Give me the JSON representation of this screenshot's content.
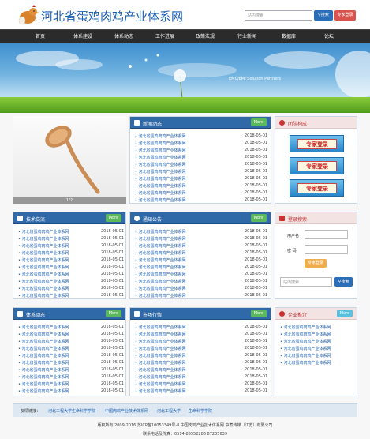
{
  "header": {
    "site_title": "河北省蛋鸡肉鸡产业体系网",
    "search_placeholder": "站内搜索",
    "search_button": "搜索",
    "login_button": "专家登录"
  },
  "nav": {
    "items": [
      "首页",
      "体系建设",
      "体系动态",
      "工作进展",
      "政策法规",
      "行业新闻",
      "数据库",
      "论坛"
    ]
  },
  "banner": {
    "text": "EMC/EMI Solution Partners"
  },
  "featured_image": {
    "caption": "1/2"
  },
  "news": {
    "title": "新闻动态",
    "more": "More",
    "items": [
      {
        "title": "河北省蛋鸡肉鸡产业体系网",
        "date": "2018-05-01"
      },
      {
        "title": "河北省蛋鸡肉鸡产业体系网",
        "date": "2018-05-01"
      },
      {
        "title": "河北省蛋鸡肉鸡产业体系网",
        "date": "2018-05-01"
      },
      {
        "title": "河北省蛋鸡肉鸡产业体系网",
        "date": "2018-05-01"
      },
      {
        "title": "河北省蛋鸡肉鸡产业体系网",
        "date": "2018-05-01"
      },
      {
        "title": "河北省蛋鸡肉鸡产业体系网",
        "date": "2018-05-01"
      },
      {
        "title": "河北省蛋鸡肉鸡产业体系网",
        "date": "2018-05-01"
      },
      {
        "title": "河北省蛋鸡肉鸡产业体系网",
        "date": "2018-05-01"
      },
      {
        "title": "河北省蛋鸡肉鸡产业体系网",
        "date": "2018-05-01"
      },
      {
        "title": "河北省蛋鸡肉鸡产业体系网",
        "date": "2018-05-01"
      }
    ]
  },
  "team": {
    "title": "团队构成",
    "experts": [
      "专家登录",
      "专家登录",
      "专家登录"
    ]
  },
  "tech": {
    "title": "技术交流",
    "more": "More",
    "items": [
      {
        "title": "河北省蛋鸡肉鸡产业体系网",
        "date": "2018-05-01"
      },
      {
        "title": "河北省蛋鸡肉鸡产业体系网",
        "date": "2018-05-01"
      },
      {
        "title": "河北省蛋鸡肉鸡产业体系网",
        "date": "2018-05-01"
      },
      {
        "title": "河北省蛋鸡肉鸡产业体系网",
        "date": "2018-05-01"
      },
      {
        "title": "河北省蛋鸡肉鸡产业体系网",
        "date": "2018-05-01"
      },
      {
        "title": "河北省蛋鸡肉鸡产业体系网",
        "date": "2018-05-01"
      },
      {
        "title": "河北省蛋鸡肉鸡产业体系网",
        "date": "2018-05-01"
      },
      {
        "title": "河北省蛋鸡肉鸡产业体系网",
        "date": "2018-05-01"
      },
      {
        "title": "河北省蛋鸡肉鸡产业体系网",
        "date": "2018-05-01"
      },
      {
        "title": "河北省蛋鸡肉鸡产业体系网",
        "date": "2018-05-01"
      }
    ]
  },
  "notice": {
    "title": "通知公告",
    "more": "More",
    "items": [
      {
        "title": "河北省蛋鸡肉鸡产业体系网",
        "date": "2018-05-01"
      },
      {
        "title": "河北省蛋鸡肉鸡产业体系网",
        "date": "2018-05-01"
      },
      {
        "title": "河北省蛋鸡肉鸡产业体系网",
        "date": "2018-05-01"
      },
      {
        "title": "河北省蛋鸡肉鸡产业体系网",
        "date": "2018-05-01"
      },
      {
        "title": "河北省蛋鸡肉鸡产业体系网",
        "date": "2018-05-01"
      },
      {
        "title": "河北省蛋鸡肉鸡产业体系网",
        "date": "2018-05-01"
      },
      {
        "title": "河北省蛋鸡肉鸡产业体系网",
        "date": "2018-05-01"
      },
      {
        "title": "河北省蛋鸡肉鸡产业体系网",
        "date": "2018-05-01"
      },
      {
        "title": "河北省蛋鸡肉鸡产业体系网",
        "date": "2018-05-01"
      },
      {
        "title": "河北省蛋鸡肉鸡产业体系网",
        "date": "2018-05-01"
      }
    ]
  },
  "login": {
    "title": "登录搜索",
    "username_label": "用户名",
    "password_label": "密 码",
    "login_button": "专家登录",
    "search_placeholder": "站内搜索",
    "search_button": "搜索"
  },
  "system": {
    "title": "体系动态",
    "more": "More",
    "items": [
      {
        "title": "河北省蛋鸡肉鸡产业体系网",
        "date": "2018-05-01"
      },
      {
        "title": "河北省蛋鸡肉鸡产业体系网",
        "date": "2018-05-01"
      },
      {
        "title": "河北省蛋鸡肉鸡产业体系网",
        "date": "2018-05-01"
      },
      {
        "title": "河北省蛋鸡肉鸡产业体系网",
        "date": "2018-05-01"
      },
      {
        "title": "河北省蛋鸡肉鸡产业体系网",
        "date": "2018-05-01"
      },
      {
        "title": "河北省蛋鸡肉鸡产业体系网",
        "date": "2018-05-01"
      },
      {
        "title": "河北省蛋鸡肉鸡产业体系网",
        "date": "2018-05-01"
      },
      {
        "title": "河北省蛋鸡肉鸡产业体系网",
        "date": "2018-05-01"
      },
      {
        "title": "河北省蛋鸡肉鸡产业体系网",
        "date": "2018-05-01"
      },
      {
        "title": "河北省蛋鸡肉鸡产业体系网",
        "date": "2018-05-01"
      }
    ]
  },
  "market": {
    "title": "市场行情",
    "more": "More",
    "items": [
      {
        "title": "河北省蛋鸡肉鸡产业体系网",
        "date": "2018-05-01"
      },
      {
        "title": "河北省蛋鸡肉鸡产业体系网",
        "date": "2018-05-01"
      },
      {
        "title": "河北省蛋鸡肉鸡产业体系网",
        "date": "2018-05-01"
      },
      {
        "title": "河北省蛋鸡肉鸡产业体系网",
        "date": "2018-05-01"
      },
      {
        "title": "河北省蛋鸡肉鸡产业体系网",
        "date": "2018-05-01"
      },
      {
        "title": "河北省蛋鸡肉鸡产业体系网",
        "date": "2018-05-01"
      },
      {
        "title": "河北省蛋鸡肉鸡产业体系网",
        "date": "2018-05-01"
      },
      {
        "title": "河北省蛋鸡肉鸡产业体系网",
        "date": "2018-05-01"
      },
      {
        "title": "河北省蛋鸡肉鸡产业体系网",
        "date": "2018-05-01"
      },
      {
        "title": "河北省蛋鸡肉鸡产业体系网",
        "date": "2018-05-01"
      }
    ]
  },
  "enterprise": {
    "title": "企业推介",
    "more": "More",
    "items": [
      {
        "title": "河北省蛋鸡肉鸡产业体系网"
      },
      {
        "title": "河北省蛋鸡肉鸡产业体系网"
      },
      {
        "title": "河北省蛋鸡肉鸡产业体系网"
      },
      {
        "title": "河北省蛋鸡肉鸡产业体系网"
      },
      {
        "title": "河北省蛋鸡肉鸡产业体系网"
      },
      {
        "title": "河北省蛋鸡肉鸡产业体系网"
      }
    ]
  },
  "links": {
    "label": "友情链接：",
    "items": [
      "河北工程大学生命科学学院",
      "中国肉鸡产业技术体系网",
      "河北工程大学",
      "生命科学学院"
    ]
  },
  "footer": {
    "copyright": "版权所有 2009-2016 苏ICP备10053349号-8 中国肉鸡产业技术体系网 中煮传媒（江苏）有限公司",
    "contact": "联系电话及传真：0514-85552286 87205639"
  },
  "colors": {
    "brand_blue": "#2f69a8",
    "nav_dark": "#2b2b2b",
    "more_green": "#5cb85c",
    "login_red": "#d9534f",
    "pink_head": "#f4e3e3"
  }
}
